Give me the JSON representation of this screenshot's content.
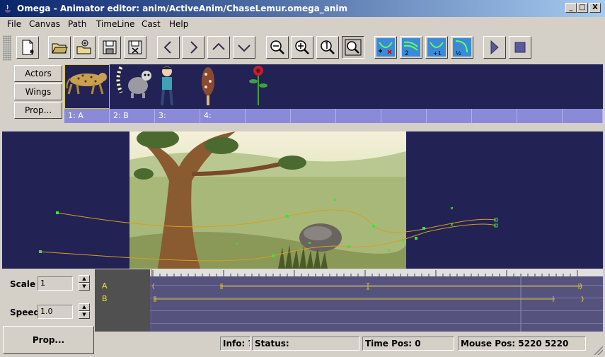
{
  "window": {
    "title": "Omega - Animator editor:  anim/ActiveAnim/ChaseLemur.omega_anim",
    "min_label": "_",
    "max_label": "□",
    "close_label": "X"
  },
  "menu": [
    "File",
    "Canvas",
    "Path",
    "TimeLine",
    "Cast",
    "Help"
  ],
  "toolbar": {
    "buttons": [
      "new-file",
      "open-folder",
      "open-network",
      "save",
      "save-as",
      "arrow-left",
      "arrow-right",
      "arrow-up",
      "arrow-down",
      "zoom-out",
      "zoom-in",
      "zoom-actual",
      "zoom-fit",
      "path-add-remove",
      "path-two",
      "path-plus-one",
      "path-half",
      "play",
      "stop"
    ],
    "path_two_label": "2",
    "path_plus_one_label": "+1",
    "path_half_label": "½"
  },
  "cast": {
    "actors_label": "Actors",
    "wings_label": "Wings",
    "prop_label": "Prop...",
    "items": [
      "leopard",
      "lemur",
      "boy",
      "ice-cream",
      "flower"
    ],
    "slots": [
      "1: A",
      "2: B",
      "3:",
      "4:",
      "",
      "",
      "",
      "",
      "",
      "",
      "",
      ""
    ]
  },
  "controls": {
    "scale_label": "Scale",
    "scale_value": "1",
    "speed_label": "Speed",
    "speed_value": "1.0",
    "prop_button": "Prop..."
  },
  "timeline": {
    "tracks": [
      "A",
      "B"
    ]
  },
  "status": {
    "info": "Info: ?",
    "status": "Status:",
    "time_pos": "Time Pos: 0",
    "mouse_pos": "Mouse Pos: 5220 5220"
  },
  "colors": {
    "title_gradient_start": "#0a246a",
    "canvas_bg": "#232254",
    "slot_bg": "#8a8ad8",
    "path_color": "#d4a020",
    "node_color": "#40e040",
    "track_label": "#f0e020"
  }
}
